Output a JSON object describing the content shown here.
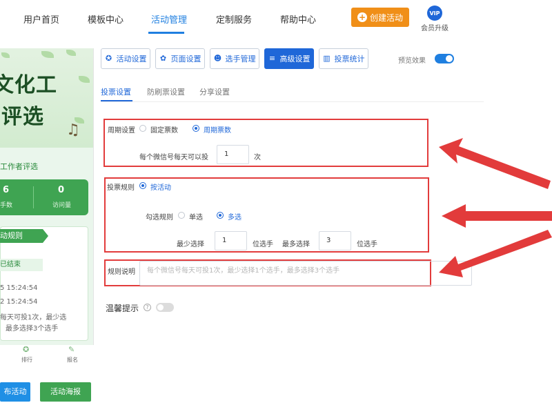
{
  "nav": {
    "items": [
      "用户首页",
      "模板中心",
      "活动管理",
      "定制服务",
      "帮助中心"
    ],
    "active": "活动管理",
    "create_button": "创建活动",
    "vip_badge": "VIP",
    "vip_label": "会员升级"
  },
  "preview": {
    "banner_line1": "文化工",
    "banner_line2": "评选",
    "subtitle": "工作者评选",
    "stats": [
      {
        "value": "6",
        "label": "手数"
      },
      {
        "value": "0",
        "label": "访问量"
      }
    ],
    "rule_tag": "动规则",
    "status": "已结束",
    "time1": "5 15:24:54",
    "time2": "2 15:24:54",
    "rule_text1": "每天可投1次，最少选",
    "rule_text2": "最多选择3个选手",
    "footer_ranking": "排行",
    "footer_signup": "报名",
    "publish_button": "布活动",
    "poster_button": "活动海报"
  },
  "tabs": [
    {
      "label": "活动设置",
      "icon": "settings-star-icon"
    },
    {
      "label": "页面设置",
      "icon": "gear-icon"
    },
    {
      "label": "选手管理",
      "icon": "users-icon"
    },
    {
      "label": "高级设置",
      "icon": "sliders-icon"
    },
    {
      "label": "投票统计",
      "icon": "bar-chart-icon"
    }
  ],
  "active_tab": "高级设置",
  "preview_effect": {
    "label": "预览效果",
    "on": true
  },
  "subtabs": [
    "投票设置",
    "防刷票设置",
    "分享设置"
  ],
  "active_subtab": "投票设置",
  "period": {
    "label": "周期设置",
    "options": [
      "固定票数",
      "周期票数"
    ],
    "selected": "周期票数",
    "per_day_label": "每个微信号每天可以投",
    "per_day_value": "1",
    "unit": "次"
  },
  "vote_rule": {
    "label": "投票规则",
    "option": "按活动",
    "check_label": "勾选规则",
    "check_options": [
      "单选",
      "多选"
    ],
    "check_selected": "多选",
    "min_label": "最少选择",
    "min_value": "1",
    "min_unit": "位选手",
    "max_label": "最多选择",
    "max_value": "3",
    "max_unit": "位选手"
  },
  "rule_desc": {
    "label": "规则说明",
    "placeholder": "每个微信号每天可投1次，最少选择1个选手，最多选择3个选手"
  },
  "tips": {
    "label": "温馨提示",
    "help": "?",
    "on": false
  },
  "colors": {
    "primary": "#1f67d8",
    "accent": "#f08f18",
    "green": "#3fa452",
    "annotation_red": "#e23b3b"
  }
}
